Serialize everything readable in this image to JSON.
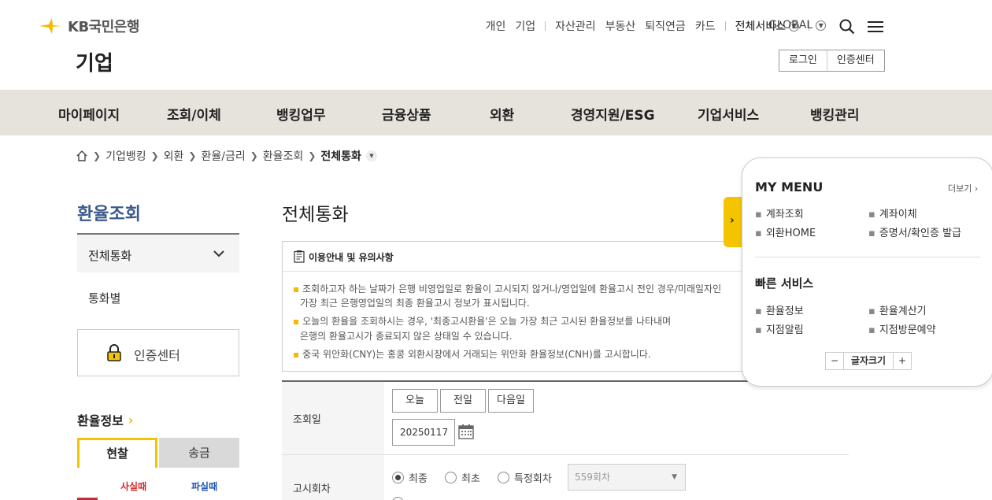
{
  "header": {
    "brand": "KB국민은행",
    "section_title": "기업",
    "top_nav": [
      "개인",
      "기업",
      "자산관리",
      "부동산",
      "퇴직연금",
      "카드"
    ],
    "all_services": "전체서비스",
    "global": "GLOBAL",
    "login": "로그인",
    "cert_center": "인증센터"
  },
  "gnb": [
    "마이페이지",
    "조회/이체",
    "뱅킹업무",
    "금융상품",
    "외환",
    "경영지원/ESG",
    "기업서비스",
    "뱅킹관리"
  ],
  "breadcrumb": [
    "기업뱅킹",
    "외환",
    "환율/금리",
    "환율조회",
    "전체통화"
  ],
  "sidebar": {
    "title": "환율조회",
    "active_item": "전체통화",
    "sub_item": "통화별",
    "cert_center": "인증센터",
    "rate_info": "환율정보",
    "tab_cash": "현찰",
    "tab_remit": "송금",
    "buy_label": "사실때",
    "sell_label": "파실때"
  },
  "main": {
    "title": "전체통화",
    "notice_title": "이용안내 및 유의사항",
    "notice_lines": [
      "조회하고자 하는 날짜가 은행 비영업일로 환율이 고시되지 않거나/영업일에 환율고시 전인 경우/미래일자인",
      "가장 최근 은행영업일의 최종 환율고시 정보가 표시됩니다.",
      "오늘의 환율을 조회하시는 경우, '최종고시환율'은 오늘 가장 최근 고시된 환율정보를 나타내며",
      "은행의 환율고시가 종료되지 않은 상태일 수 있습니다.",
      "중국 위안화(CNY)는 홍콩 외환시장에서 거래되는 위안화 환율정보(CNH)를 고시합니다."
    ],
    "form": {
      "date_label": "조회일",
      "btn_today": "오늘",
      "btn_prev": "전일",
      "btn_next": "다음일",
      "date_value": "20250117",
      "round_label": "고시회차",
      "radio_latest": "최종",
      "radio_first": "최초",
      "radio_specific": "특정회차",
      "round_select": "559회차"
    }
  },
  "my_menu": {
    "title": "MY MENU",
    "more": "더보기",
    "items": [
      "계좌조회",
      "계좌이체",
      "외환HOME",
      "증명서/확인증 발급"
    ],
    "quick_title": "빠른 서비스",
    "quick_items": [
      "환율정보",
      "환율계산기",
      "지점알림",
      "지점방문예약"
    ],
    "font_size": "글자크기",
    "font_minus": "−",
    "font_plus": "+"
  },
  "colors": {
    "accent": "#f5c400",
    "gnb_bg": "#e6e2dc",
    "title_blue": "#3c5a8c",
    "buy_red": "#d62b2b",
    "sell_blue": "#1f55b5"
  }
}
